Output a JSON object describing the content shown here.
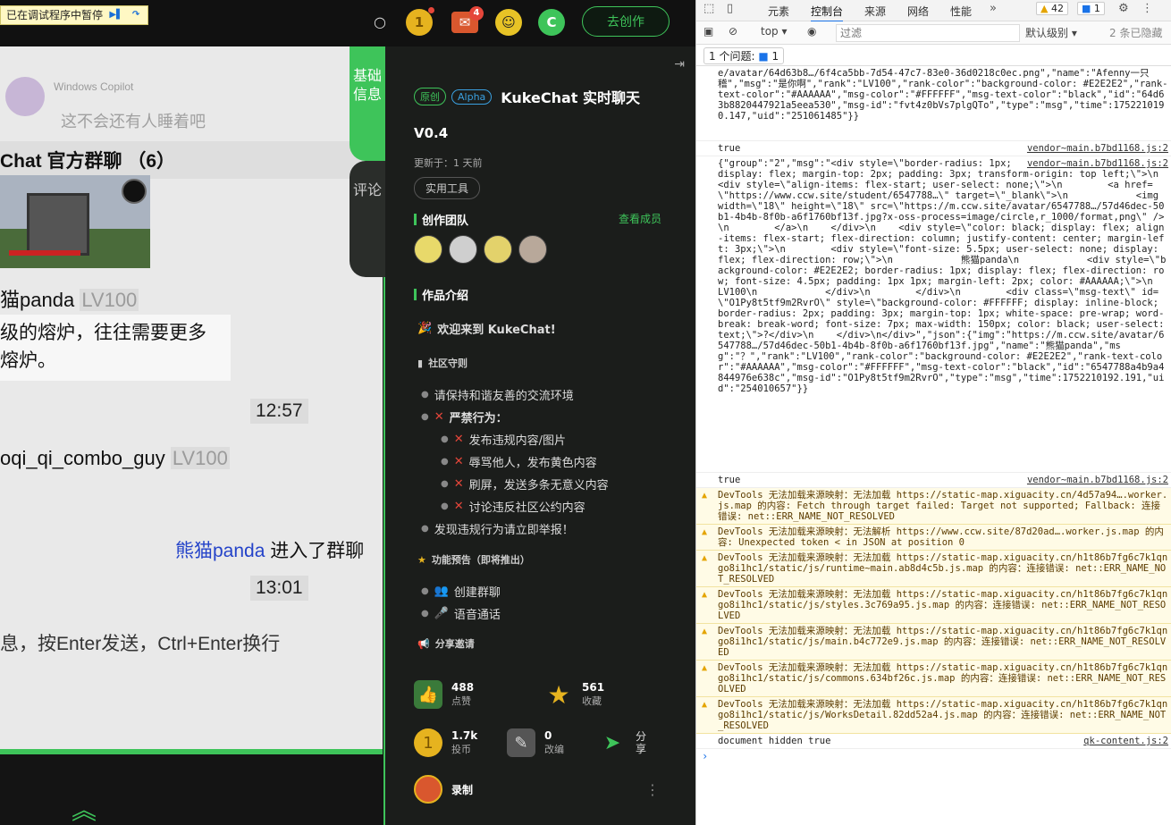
{
  "debugger_bar": {
    "text": "已在调试程序中暂停"
  },
  "topbar": {
    "search_icon": "search-icon",
    "coin_icon": "coin-icon",
    "mail_badge": "4",
    "create_label": "去创作"
  },
  "chat": {
    "bg_sender": "Windows Copilot",
    "bg_message": "这不会还有人睡着吧",
    "title": "Chat 官方群聊 （6）",
    "msg1_user": "猫panda",
    "msg1_level": "LV100",
    "msg1_text_line1": "级的熔炉，往往需要更多",
    "msg1_text_line2": "熔炉。",
    "time1": "12:57",
    "msg2_user": "oqi_qi_combo_guy",
    "msg2_level": "LV100",
    "join_user": "熊猫panda",
    "join_text": " 进入了群聊",
    "time2": "13:01",
    "input_hint": "息，按Enter发送，Ctrl+Enter换行"
  },
  "panel": {
    "tab_basic": "基础信息",
    "tab_comment": "评论",
    "tag_original": "原创",
    "tag_alpha": "Alpha",
    "title": "KukeChat 实时聊天",
    "version": "V0.4",
    "updated": "更新于：1 天前",
    "tool_tag": "实用工具",
    "team_heading": "创作团队",
    "view_members": "查看成员",
    "intro_heading": "作品介绍",
    "welcome": "欢迎来到 KukeChat!",
    "rules_heading": "社区守则",
    "rule1": "请保持和谐友善的交流环境",
    "forbidden": "严禁行为：",
    "forbid1": "发布违规内容/图片",
    "forbid2": "辱骂他人，发布黄色内容",
    "forbid3": "刷屏，发送多条无意义内容",
    "forbid4": "讨论违反社区公约内容",
    "report": "发现违规行为请立即举报！",
    "preview_heading": "功能预告（即将推出）",
    "feature1": "创建群聊",
    "feature2": "语音通话",
    "share_heading": "分享邀请",
    "likes": "488",
    "likes_label": "点赞",
    "favs": "561",
    "favs_label": "收藏",
    "coins": "1.7k",
    "coins_label": "投币",
    "adapt": "0",
    "adapt_label": "改编",
    "share_label": "分享",
    "record_label": "录制"
  },
  "devtools": {
    "tabs": [
      "元素",
      "控制台",
      "来源",
      "网络",
      "性能"
    ],
    "active_tab": "控制台",
    "warn_count": "42",
    "info_count": "1",
    "context": "top",
    "filter_placeholder": "过滤",
    "level": "默认级别",
    "hidden": "2 条已隐藏",
    "issues": "1 个问题:",
    "issues_count": "1",
    "log1": "e/avatar/64d63b8…/6f4ca5bb-7d54-47c7-83e0-36d0218c0ec.png\",\"name\":\"Afenny一只稽\",\"msg\":\"是你啊\",\"rank\":\"LV100\",\"rank-color\":\"background-color: #E2E2E2\",\"rank-text-color\":\"#AAAAAA\",\"msg-color\":\"#FFFFFF\",\"msg-text-color\":\"black\",\"id\":\"64d63b8820447921a5eea530\",\"msg-id\":\"fvt4z0bVs7plgQTo\",\"type\":\"msg\",\"time\":1752210190.147,\"uid\":\"251061485\"}}",
    "log2": "true",
    "log2_src": "vendor~main.b7bd1168.js:2",
    "log3_src": "vendor~main.b7bd1168.js:2",
    "log3": "{\"group\":\"2\",\"msg\":\"<div style=\\\"border-radius: 1px; display: flex; margin-top: 2px; padding: 3px; transform-origin: top left;\\\">\\n    <div style=\\\"align-items: flex-start; user-select: none;\\\">\\n        <a href=\\\"https://www.ccw.site/student/6547788…\\\" target=\\\"_blank\\\">\\n            <img width=\\\"18\\\" height=\\\"18\\\" src=\\\"https://m.ccw.site/avatar/6547788…/57d46dec-50b1-4b4b-8f0b-a6f1760bf13f.jpg?x-oss-process=image/circle,r_1000/format,png\\\" />\\n        </a>\\n    </div>\\n    <div style=\\\"color: black; display: flex; align-items: flex-start; flex-direction: column; justify-content: center; margin-left: 3px;\\\">\\n        <div style=\\\"font-size: 5.5px; user-select: none; display: flex; flex-direction: row;\\\">\\n            熊猫panda\\n            <div style=\\\"background-color: #E2E2E2; border-radius: 1px; display: flex; flex-direction: row; font-size: 4.5px; padding: 1px 1px; margin-left: 2px; color: #AAAAAA;\\\">\\n                LV100\\n            </div>\\n        </div>\\n        <div class=\\\"msg-text\\\" id=\\\"O1Py8t5tf9m2RvrO\\\" style=\\\"background-color: #FFFFFF; display: inline-block; border-radius: 2px; padding: 3px; margin-top: 1px; white-space: pre-wrap; word-break: break-word; font-size: 7px; max-width: 150px; color: black; user-select: text;\\\">?</div>\\n    </div>\\n</div>\",\"json\":{\"img\":\"https://m.ccw.site/avatar/6547788…/57d46dec-50b1-4b4b-8f0b-a6f1760bf13f.jpg\",\"name\":\"熊猫panda\",\"msg\":\"？\",\"rank\":\"LV100\",\"rank-color\":\"background-color: #E2E2E2\",\"rank-text-color\":\"#AAAAAA\",\"msg-color\":\"#FFFFFF\",\"msg-text-color\":\"black\",\"id\":\"6547788a4b9a4844976e638c\",\"msg-id\":\"O1Py8t5tf9m2RvrO\",\"type\":\"msg\",\"time\":1752210192.191,\"uid\":\"254010657\"}}",
    "log4": "true",
    "log4_src": "vendor~main.b7bd1168.js:2",
    "warn1": "DevTools 无法加载来源映射：无法加载 https://static-map.xiguacity.cn/4d57a94….worker.js.map 的内容: Fetch through target failed: Target not supported; Fallback: 连接错误: net::ERR_NAME_NOT_RESOLVED",
    "warn2": "DevTools 无法加载来源映射：无法解析 https://www.ccw.site/87d20ad….worker.js.map 的内容: Unexpected token < in JSON at position 0",
    "warn3": "DevTools 无法加载来源映射：无法加载 https://static-map.xiguacity.cn/h1t86b7fg6c7k1qngo8i1hc1/static/js/runtime~main.ab8d4c5b.js.map 的内容：连接错误: net::ERR_NAME_NOT_RESOLVED",
    "warn4": "DevTools 无法加载来源映射：无法加载 https://static-map.xiguacity.cn/h1t86b7fg6c7k1qngo8i1hc1/static/js/styles.3c769a95.js.map 的内容：连接错误: net::ERR_NAME_NOT_RESOLVED",
    "warn5": "DevTools 无法加载来源映射：无法加载 https://static-map.xiguacity.cn/h1t86b7fg6c7k1qngo8i1hc1/static/js/main.b4c772e9.js.map 的内容：连接错误: net::ERR_NAME_NOT_RESOLVED",
    "warn6": "DevTools 无法加载来源映射：无法加载 https://static-map.xiguacity.cn/h1t86b7fg6c7k1qngo8i1hc1/static/js/commons.634bf26c.js.map 的内容：连接错误: net::ERR_NAME_NOT_RESOLVED",
    "warn7": "DevTools 无法加载来源映射：无法加载 https://static-map.xiguacity.cn/h1t86b7fg6c7k1qngo8i1hc1/static/js/WorksDetail.82dd52a4.js.map 的内容：连接错误: net::ERR_NAME_NOT_RESOLVED",
    "log5": "document hidden true",
    "log5_src": "qk-content.js:2"
  }
}
